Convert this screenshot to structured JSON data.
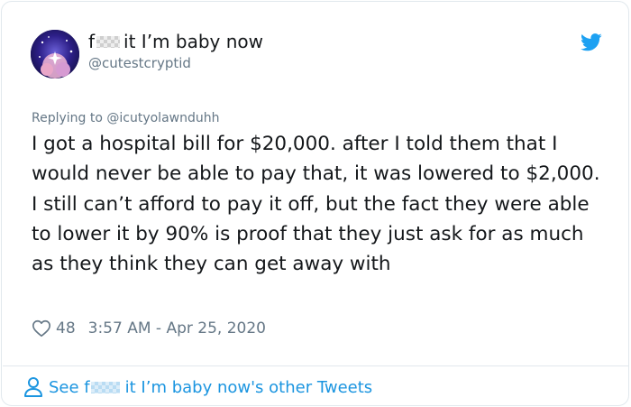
{
  "author": {
    "display_name_start": "f",
    "display_name_end": "it I’m baby now",
    "handle": "@cutestcryptid",
    "avatar_icon": "sparkle-avatar-icon"
  },
  "reply": {
    "text": "Replying to @icutyolawnduhh"
  },
  "tweet": {
    "text": "I got a hospital bill for $20,000. after I told them that I would never be able to pay that, it was lowered to $2,000. I still can’t afford to pay it off, but the fact they were able to lower it by 90% is proof that they just ask for as much as they think they can get away with",
    "likes": "48",
    "timestamp": "3:57 AM - Apr 25, 2020"
  },
  "footer": {
    "link_start": "See f",
    "link_end": "it I’m baby now's other Tweets"
  },
  "colors": {
    "twitter_blue": "#1da1f2",
    "link_blue": "#1b95e0",
    "secondary_text": "#657786",
    "primary_text": "#14171a",
    "border": "#e1e8ed"
  },
  "icons": [
    "twitter-bird-icon",
    "heart-icon",
    "person-icon"
  ]
}
